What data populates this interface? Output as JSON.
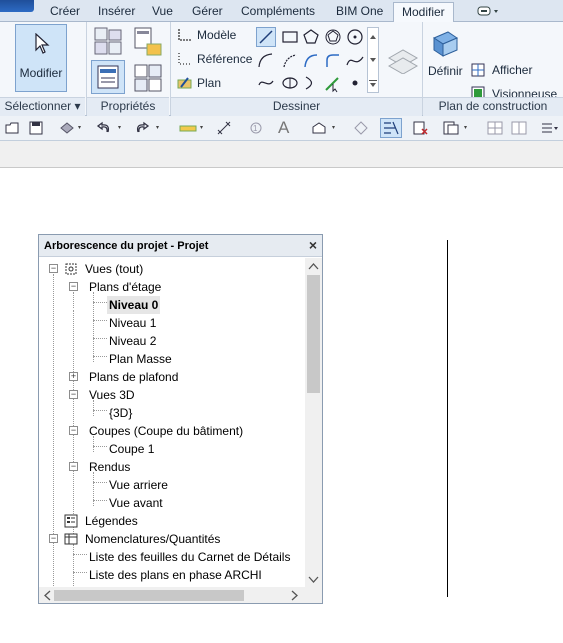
{
  "tabs": [
    "Créer",
    "Insérer",
    "Vue",
    "Gérer",
    "Compléments",
    "BIM One",
    "Modifier"
  ],
  "active_tab": "Modifier",
  "ribbon": {
    "modify_label": "Modifier",
    "modele_label": "Modèle",
    "reference_label": "Référence",
    "plan_label": "Plan",
    "definir_label": "Définir",
    "afficher_label": "Afficher",
    "visionneuse_label": "Visionneuse",
    "panels": {
      "selectionner": "Sélectionner ▾",
      "proprietes": "Propriétés",
      "dessiner": "Dessiner",
      "plan_construction": "Plan de construction"
    }
  },
  "browser": {
    "title": "Arborescence du projet - Projet",
    "close": "×",
    "nodes": [
      {
        "label": "Vues (tout)",
        "expander": "−"
      },
      {
        "label": "Plans d'étage",
        "expander": "−"
      },
      {
        "label": "Niveau 0",
        "selected": true
      },
      {
        "label": "Niveau 1"
      },
      {
        "label": "Niveau 2"
      },
      {
        "label": "Plan Masse"
      },
      {
        "label": "Plans de plafond",
        "expander": "+"
      },
      {
        "label": "Vues 3D",
        "expander": "−"
      },
      {
        "label": "{3D}"
      },
      {
        "label": "Coupes (Coupe du bâtiment)",
        "expander": "−"
      },
      {
        "label": "Coupe 1"
      },
      {
        "label": "Rendus",
        "expander": "−"
      },
      {
        "label": "Vue arriere"
      },
      {
        "label": "Vue avant"
      },
      {
        "label": "Légendes"
      },
      {
        "label": "Nomenclatures/Quantités",
        "expander": "−"
      },
      {
        "label": "Liste des feuilles du Carnet de Détails"
      },
      {
        "label": "Liste des plans en phase ARCHI"
      }
    ]
  },
  "colors": {
    "ribbon_bg": "#f4f7fb",
    "active_button": "#cfe4f8",
    "accent": "#2d6bc4"
  }
}
